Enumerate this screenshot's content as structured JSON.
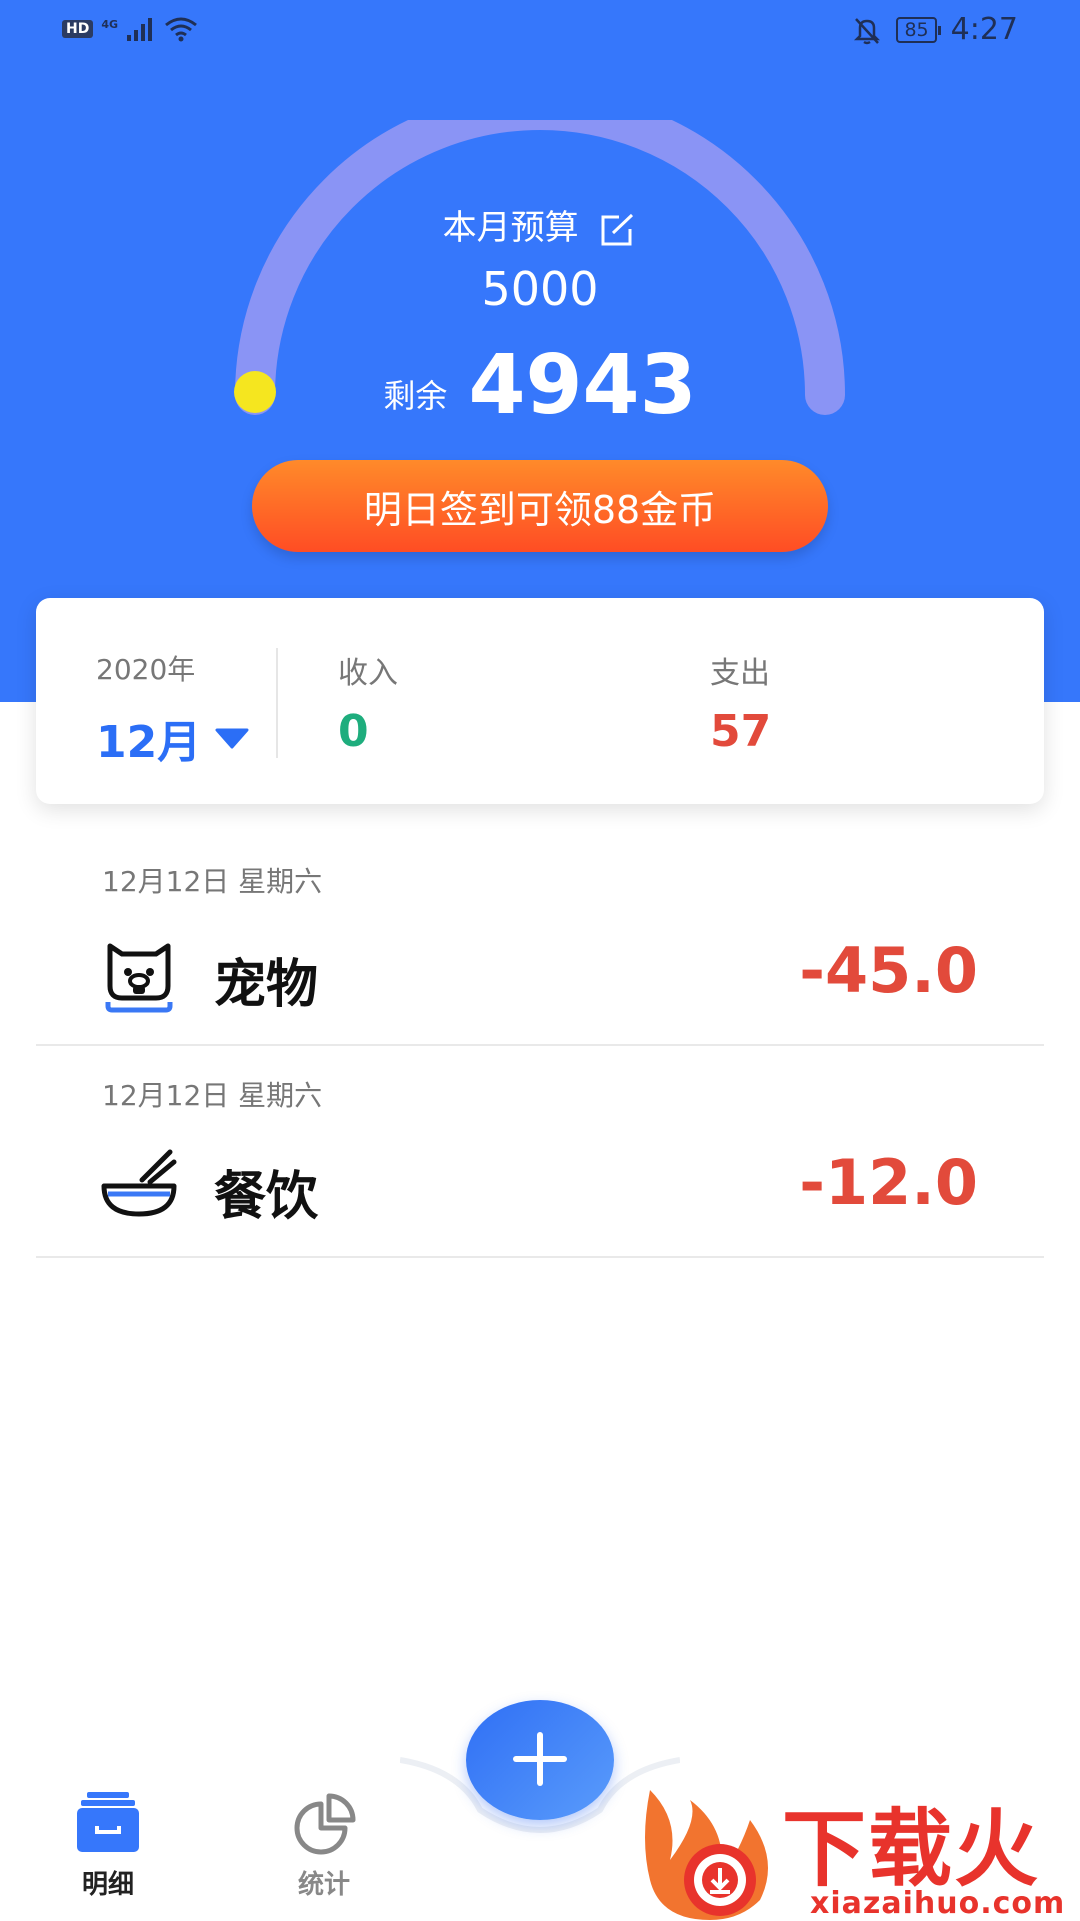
{
  "status_bar": {
    "hd_label": "HD",
    "network_label": "4G",
    "battery_level": "85",
    "time": "4:27"
  },
  "budget": {
    "title": "本月预算",
    "amount": "5000",
    "remaining_label": "剩余",
    "remaining_value": "4943",
    "spent_fraction": 0.0114
  },
  "signin_button": {
    "label": "明日签到可领88金币"
  },
  "summary": {
    "year": "2020年",
    "month": "12月",
    "income_label": "收入",
    "income_value": "0",
    "expense_label": "支出",
    "expense_value": "57"
  },
  "records": [
    {
      "date": "12月12日 星期六",
      "category": "宠物",
      "amount": "-45.0",
      "icon": "pet-icon"
    },
    {
      "date": "12月12日 星期六",
      "category": "餐饮",
      "amount": "-12.0",
      "icon": "bowl-icon"
    }
  ],
  "tabbar": {
    "tabs": [
      {
        "label": "明细",
        "icon": "detail-icon",
        "active": true
      },
      {
        "label": "统计",
        "icon": "stats-pie-icon",
        "active": false
      }
    ],
    "add_button_icon": "plus-icon"
  },
  "watermark": {
    "brand": "下载火",
    "url": "xiazaihuo.com"
  },
  "colors": {
    "header_blue": "#3677fb",
    "expense_red": "#e24a3b",
    "income_green": "#1ead7d",
    "month_blue": "#2b6ef6",
    "button_orange": "#ff6b26"
  }
}
